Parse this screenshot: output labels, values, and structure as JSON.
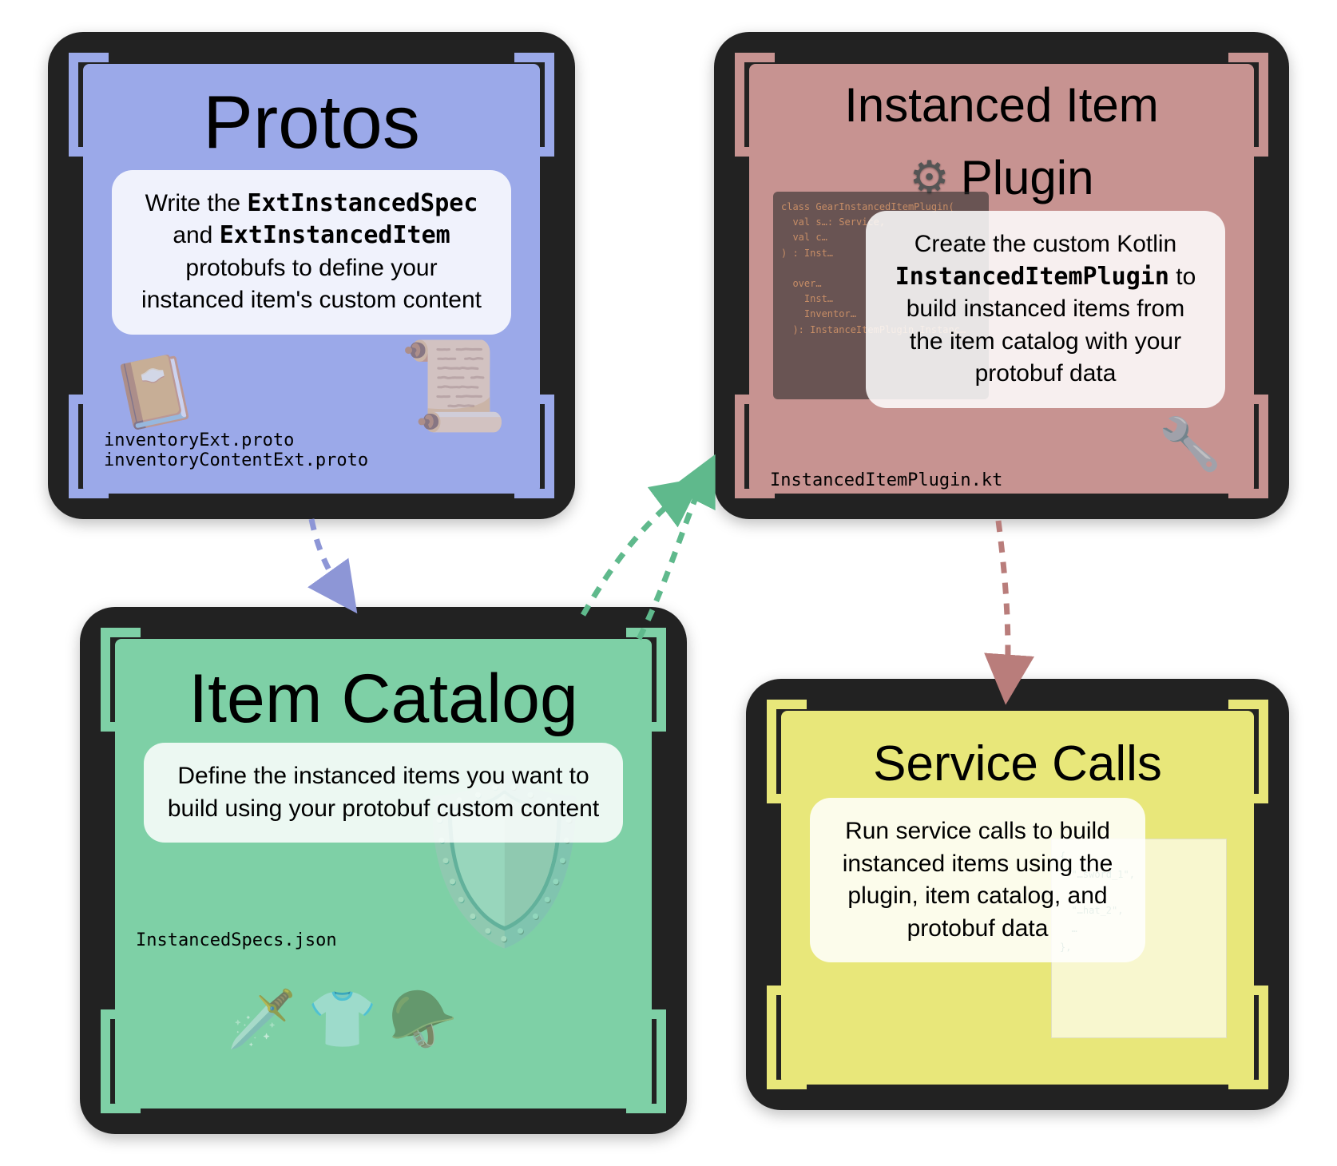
{
  "cards": {
    "protos": {
      "title": "Protos",
      "desc_prefix": "Write the ",
      "code1": "ExtInstancedSpec",
      "mid": " and ",
      "code2": "ExtInstancedItem",
      "desc_suffix": " protobufs to define your instanced item's custom content",
      "files": "inventoryExt.proto\ninventoryContentExt.proto"
    },
    "plugin": {
      "title_line1": "Instanced Item",
      "title_line2": "Plugin",
      "gear_label": "gear",
      "desc_prefix": "Create the custom Kotlin ",
      "code1": "InstancedItemPlugin",
      "desc_suffix": " to build instanced items from the item catalog with your protobuf data",
      "files": "InstancedItemPlugin.kt"
    },
    "catalog": {
      "title": "Item Catalog",
      "desc": "Define the instanced items you want to build using your protobuf custom content",
      "files": "InstancedSpecs.json"
    },
    "calls": {
      "title": "Service Calls",
      "desc": "Run service calls to build instanced items using the plugin, item catalog, and protobuf data"
    }
  },
  "colors": {
    "protos": "#9ba9e9",
    "plugin": "#c79391",
    "catalog": "#7ed0a6",
    "calls": "#e8e77a"
  },
  "arrows": [
    {
      "name": "protos-to-catalog",
      "color": "#8d96d6"
    },
    {
      "name": "catalog-to-plugin",
      "color": "#5fb98c"
    },
    {
      "name": "plugin-to-calls",
      "color": "#b97d7b"
    }
  ]
}
